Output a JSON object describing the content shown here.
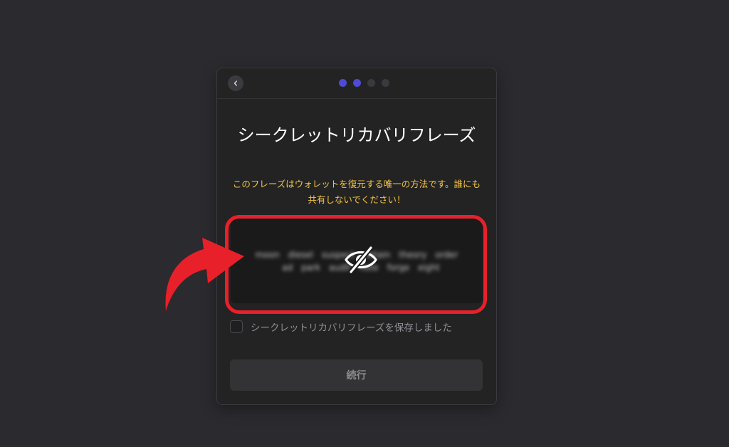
{
  "header": {
    "back_icon": "chevron-left-icon",
    "steps": [
      true,
      true,
      false,
      false
    ]
  },
  "title": "シークレットリカバリフレーズ",
  "warning": "このフレーズはウォレットを復元する唯一の方法です。誰にも共有しないでください！",
  "phrase": {
    "hidden": true,
    "toggle_icon": "eye-off-icon",
    "words": [
      "moon",
      "diesel",
      "suspect",
      "obtain",
      "theory",
      "order",
      "",
      "ad",
      "park",
      "audit",
      "note",
      "forge",
      "eight"
    ]
  },
  "save_checkbox": {
    "label": "シークレットリカバリフレーズを保存しました",
    "checked": false
  },
  "continue_button": {
    "label": "続行"
  },
  "colors": {
    "accent": "#4f4ad8",
    "warning": "#f5c542",
    "highlight": "#e8202a"
  }
}
